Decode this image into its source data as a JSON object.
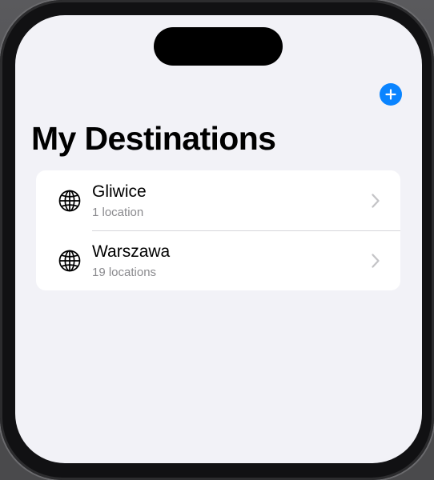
{
  "header": {
    "title": "My Destinations",
    "add_button_icon": "plus-circle-icon"
  },
  "destinations": [
    {
      "name": "Gliwice",
      "count_label": "1 location",
      "icon": "globe-icon"
    },
    {
      "name": "Warszawa",
      "count_label": "19 locations",
      "icon": "globe-icon"
    }
  ],
  "colors": {
    "accent": "#0a84ff",
    "background": "#f2f2f7",
    "card": "#ffffff",
    "secondary_text": "#8a8a8e",
    "chevron": "#c4c4c7"
  }
}
